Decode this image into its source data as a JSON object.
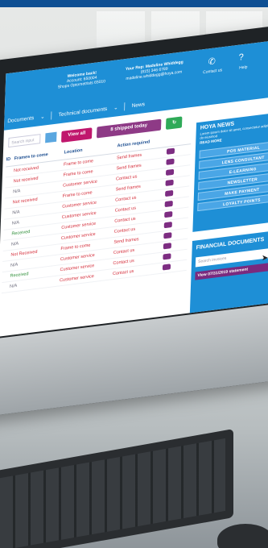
{
  "header": {
    "welcome_title": "Welcome back!",
    "account_line": "Account: 650004",
    "account_name": "Shops Optometrists 65010",
    "rep_title": "Your Rep: Madeline Whiddegg",
    "rep_phone": "(815) 346 6789",
    "rep_email": "madeline.whiddegg@hoya.com",
    "contact_label": "Contact us",
    "help_label": "Help",
    "phone_icon": "phone-icon",
    "help_icon": "help-circle-icon"
  },
  "nav": {
    "items": [
      "Documents",
      "Technical documents",
      "News"
    ]
  },
  "filters": {
    "search_placeholder": "Search input",
    "view_all": "View all",
    "shipped_today": "8 shipped today",
    "refresh_symbol": "↻"
  },
  "table": {
    "headers": [
      "ID",
      "Frames to come",
      "Location",
      "Action required",
      ""
    ],
    "rows": [
      {
        "status": "Not received",
        "location": "Frame to come",
        "action": "Send frames",
        "status_color": "red"
      },
      {
        "status": "Not received",
        "location": "Frame to come",
        "action": "Send frames",
        "status_color": "red"
      },
      {
        "status": "N/A",
        "location": "Customer service",
        "action": "Contact us",
        "status_color": "grey"
      },
      {
        "status": "Not received",
        "location": "Frame to come",
        "action": "Send frames",
        "status_color": "red"
      },
      {
        "status": "N/A",
        "location": "Customer service",
        "action": "Contact us",
        "status_color": "grey"
      },
      {
        "status": "N/A",
        "location": "Customer service",
        "action": "Contact us",
        "status_color": "grey"
      },
      {
        "status": "Received",
        "location": "Customer service",
        "action": "Contact us",
        "status_color": "green"
      },
      {
        "status": "N/A",
        "location": "Customer service",
        "action": "Contact us",
        "status_color": "grey"
      },
      {
        "status": "Not Received",
        "location": "Frame to come",
        "action": "Send frames",
        "status_color": "red"
      },
      {
        "status": "N/A",
        "location": "Customer service",
        "action": "Contact us",
        "status_color": "grey"
      },
      {
        "status": "Received",
        "location": "Customer service",
        "action": "Contact us",
        "status_color": "green"
      },
      {
        "status": "N/A",
        "location": "Customer service",
        "action": "Contact us",
        "status_color": "grey"
      }
    ]
  },
  "hoya_news": {
    "title": "HOYA NEWS",
    "body": "Lorem ipsum dolor sit amet, consectetur adipiscing elit, sed do eiusmod",
    "read_more": "READ MORE",
    "pills": [
      "POS MATERIAL",
      "LENS CONSULTANT",
      "E-LEARNING",
      "NEWSLETTER",
      "MAKE PAYMENT",
      "LOYALTY POINTS"
    ]
  },
  "financial": {
    "title": "FINANCIAL DOCUMENTS",
    "search_placeholder": "Search invoices",
    "view_statement": "View 07/31/2019 statement"
  },
  "colors": {
    "header_blue": "#1e8fd6",
    "magenta": "#c0176d",
    "purple": "#8e3a86",
    "green": "#2faa58",
    "topbar": "#0e4f93"
  }
}
